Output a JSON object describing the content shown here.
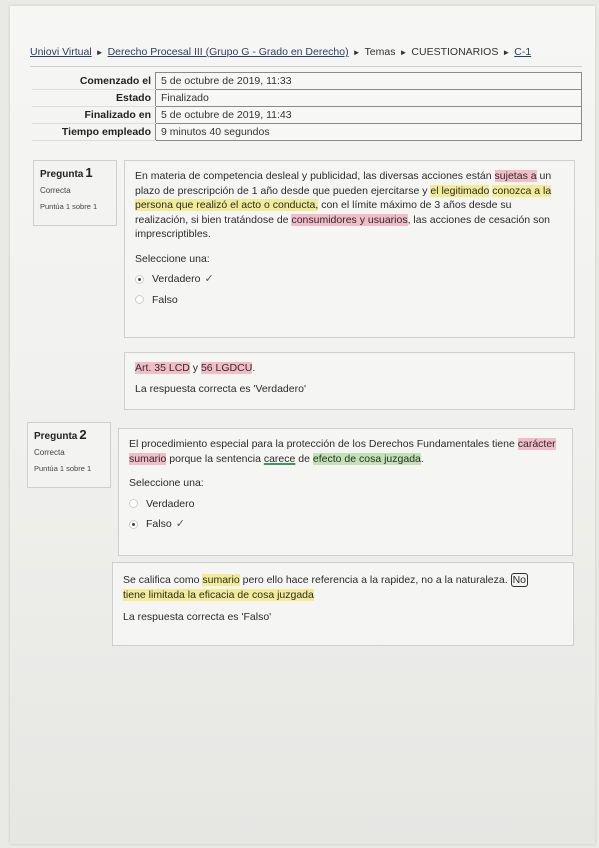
{
  "breadcrumb": {
    "items": [
      "Uniovi Virtual",
      "Derecho Procesal III (Grupo G - Grado en Derecho)",
      "Temas",
      "CUESTIONARIOS",
      "C-1"
    ],
    "separator": "►"
  },
  "summary": {
    "rows": [
      {
        "label": "Comenzado el",
        "value": "5 de octubre de 2019, 11:33"
      },
      {
        "label": "Estado",
        "value": "Finalizado"
      },
      {
        "label": "Finalizado en",
        "value": "5 de octubre de 2019, 11:43"
      },
      {
        "label": "Tiempo empleado",
        "value": "9 minutos 40 segundos"
      }
    ]
  },
  "questions": [
    {
      "label": "Pregunta",
      "number": "1",
      "state": "Correcta",
      "grade": "Puntúa 1 sobre 1",
      "text": {
        "a": "En materia de competencia desleal y publicidad, las diversas acciones están ",
        "b": "sujetas a",
        "c": " un plazo de prescripción de 1 año desde que pueden ejercitarse y ",
        "d": "el legitimado",
        "e": "conozca a la persona que realizó el acto o conducta,",
        "f": " con el límite máximo de 3 años desde su realización, si bien tratándose de ",
        "g": "consumidores y usuarios",
        "h": ", las acciones de cesación son imprescriptibles."
      },
      "prompt": "Seleccione una:",
      "options": [
        "Verdadero",
        "Falso"
      ],
      "selected": 0,
      "check": "✓",
      "feedback": {
        "general_a": "Art. 35 LCD",
        "general_b": " y ",
        "general_c": "56 LGDCU",
        "general_d": ".",
        "right_answer": "La respuesta correcta es 'Verdadero'"
      }
    },
    {
      "label": "Pregunta",
      "number": "2",
      "state": "Correcta",
      "grade": "Puntúa 1 sobre 1",
      "text": {
        "a": "El procedimiento especial para la protección de los Derechos Fundamentales tiene",
        "b": "carácter sumario",
        "c": " porque la sentencia ",
        "d": "carece",
        "e": " de ",
        "f": "efecto de cosa juzgada",
        "g": "."
      },
      "prompt": "Seleccione una:",
      "options": [
        "Verdadero",
        "Falso"
      ],
      "selected": 1,
      "check": "✓",
      "feedback": {
        "a": "Se califica como ",
        "b": "sumario",
        "c": " pero ello hace referencia a la rapidez, no a la naturaleza. ",
        "d": "No",
        "e": "tiene limitada la eficacia de cosa juzgada",
        "right_answer": "La respuesta correcta es 'Falso'"
      }
    }
  ]
}
